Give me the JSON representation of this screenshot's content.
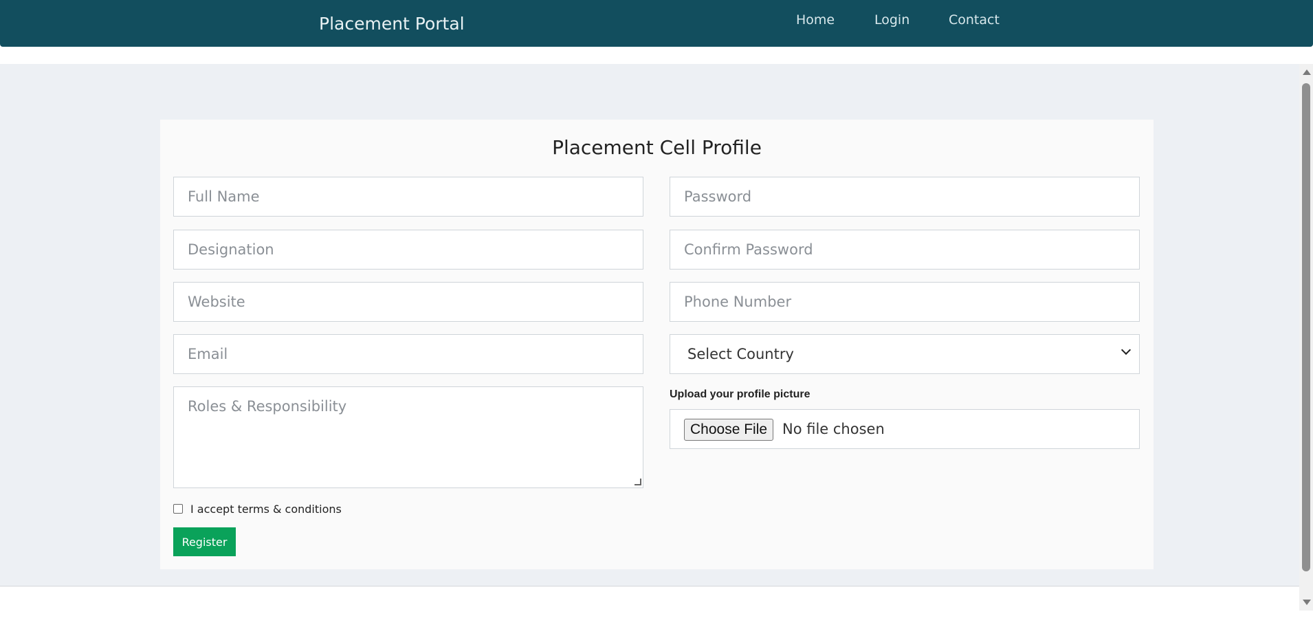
{
  "nav": {
    "brand": "Placement Portal",
    "links": {
      "home": "Home",
      "login": "Login",
      "contact": "Contact"
    }
  },
  "form": {
    "title": "Placement Cell Profile",
    "left": {
      "full_name": "Full Name",
      "designation": "Designation",
      "website": "Website",
      "email": "Email",
      "roles": "Roles & Responsibility"
    },
    "right": {
      "password": "Password",
      "confirm_password": "Confirm Password",
      "phone": "Phone Number",
      "country_selected": "Select Country",
      "upload_label": "Upload your profile picture",
      "choose_file": "Choose File",
      "no_file": "No file chosen"
    },
    "terms_label": "I accept terms & conditions",
    "register": "Register"
  }
}
